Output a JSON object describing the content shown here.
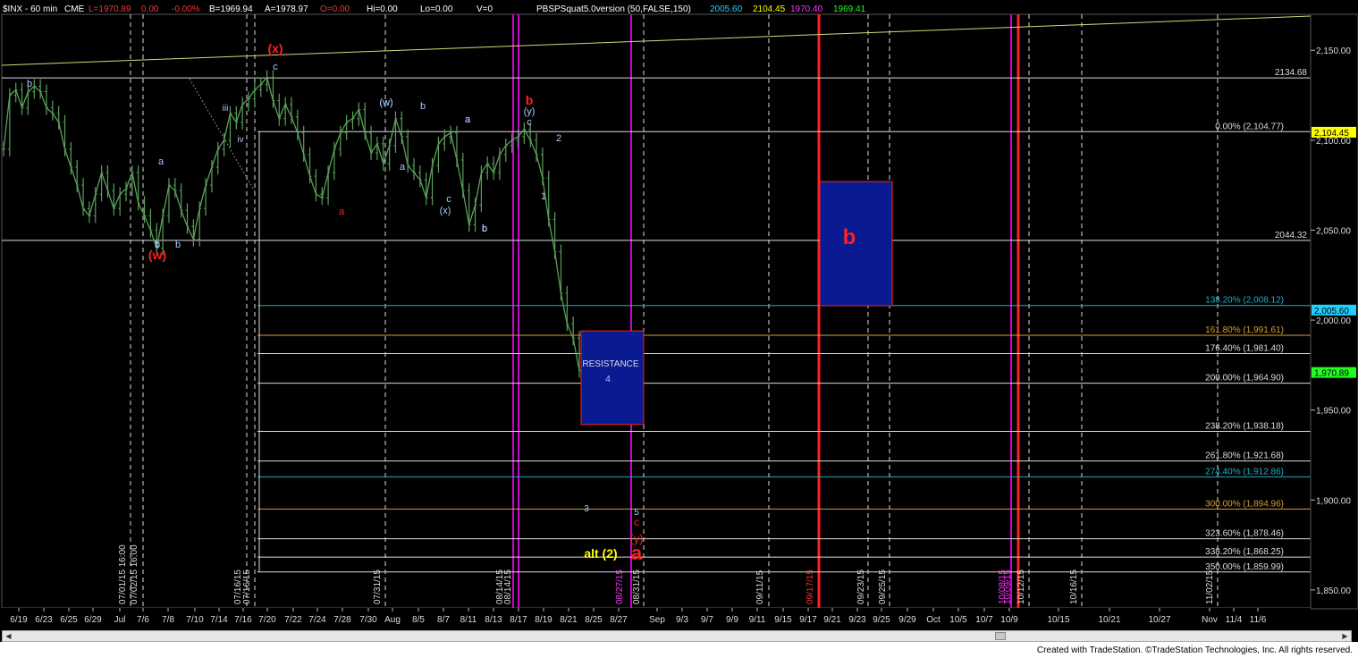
{
  "header": {
    "symbol": "$INX - 60 min",
    "exchange": "CME",
    "last": "L=1970.89",
    "change": "0.00",
    "pct": "-0.00%",
    "bid": "B=1969.94",
    "ask": "A=1978.97",
    "ask_extra": "O=0.00",
    "hi": "Hi=0.00",
    "lo": "Lo=0.00",
    "vol": "V=0",
    "indicator": "PBSPSquat5.0version (50,FALSE,150)",
    "ind_v1": "2005.60",
    "ind_v2": "2104.45",
    "ind_v3": "1970.40",
    "ind_v4": "1969.41"
  },
  "colors": {
    "background": "#000000",
    "price_bars": "#5aa05a",
    "fib_lines": "#dcdcdc",
    "channel_line": "#d7d77a",
    "red_lines": "#ff2020",
    "magenta_lines": "#d000d0",
    "resistance_box": "#0a1a90",
    "label_red": "#ff2020",
    "label_blue": "#aac8ff",
    "label_yellow": "#ffff00"
  },
  "chart_data": {
    "type": "line",
    "title": "$INX - 60 min",
    "ylim": [
      1840,
      2170
    ],
    "x_ticks": [
      "6/19",
      "6/23",
      "6/25",
      "6/29",
      "Jul",
      "7/6",
      "7/8",
      "7/10",
      "7/14",
      "7/16",
      "7/20",
      "7/22",
      "7/24",
      "7/28",
      "7/30",
      "Aug",
      "8/5",
      "8/7",
      "8/11",
      "8/13",
      "8/17",
      "8/19",
      "8/21",
      "8/25",
      "8/27",
      "Sep",
      "9/3",
      "9/7",
      "9/9",
      "9/11",
      "9/15",
      "9/17",
      "9/21",
      "9/23",
      "9/25",
      "9/29",
      "Oct",
      "10/5",
      "10/7",
      "10/9",
      "10/15",
      "10/21",
      "10/27",
      "Nov",
      "11/4",
      "11/6"
    ],
    "y_ticks": [
      "2,150.00",
      "2,100.00",
      "2,050.00",
      "2,000.00",
      "1,950.00",
      "1,900.00",
      "1,850.00"
    ],
    "y_tick_values": [
      2150,
      2100,
      2050,
      2000,
      1950,
      1900,
      1850
    ],
    "price_tags": [
      {
        "label": "2,104.45",
        "value": 2104.45,
        "color": "#ffff00"
      },
      {
        "label": "2,005.60",
        "value": 2005.6,
        "color": "#20d0ff"
      },
      {
        "label": "1,970.89",
        "value": 1970.89,
        "color": "#20ff20"
      }
    ],
    "series": [
      {
        "values": [
          2095,
          2125,
          2128,
          2118,
          2127,
          2130,
          2127,
          2118,
          2115,
          2110,
          2095,
          2085,
          2075,
          2062,
          2058,
          2070,
          2082,
          2072,
          2062,
          2070,
          2073,
          2082,
          2065,
          2058,
          2050,
          2040,
          2058,
          2075,
          2072,
          2061,
          2052,
          2045,
          2062,
          2075,
          2085,
          2095,
          2100,
          2115,
          2110,
          2120,
          2123,
          2128,
          2131,
          2135,
          2122,
          2112,
          2120,
          2113,
          2104,
          2092,
          2080,
          2070,
          2068,
          2082,
          2095,
          2104,
          2110,
          2112,
          2117,
          2104,
          2093,
          2098,
          2087,
          2097,
          2112,
          2102,
          2086,
          2082,
          2078,
          2068,
          2086,
          2098,
          2102,
          2104,
          2089,
          2072,
          2053,
          2064,
          2082,
          2087,
          2082,
          2092,
          2097,
          2100,
          2102,
          2106,
          2100,
          2092,
          2079,
          2056,
          2038,
          2015,
          1998,
          1990,
          1972
        ]
      }
    ],
    "fib_levels": [
      {
        "label": "0.00% (2,104.77)",
        "value": 2104.77,
        "color": "#dcdcdc"
      },
      {
        "label": "138.20% (2,008.12)",
        "value": 2008.12,
        "color": "#20b0c0"
      },
      {
        "label": "161.80% (1,991.61)",
        "value": 1991.61,
        "color": "#d7a030"
      },
      {
        "label": "176.40% (1,981.40)",
        "value": 1981.4,
        "color": "#dcdcdc"
      },
      {
        "label": "200.00% (1,964.90)",
        "value": 1964.9,
        "color": "#dcdcdc"
      },
      {
        "label": "238.20% (1,938.18)",
        "value": 1938.18,
        "color": "#dcdcdc"
      },
      {
        "label": "261.80% (1,921.68)",
        "value": 1921.68,
        "color": "#dcdcdc"
      },
      {
        "label": "274.40% (1,912.86)",
        "value": 1912.86,
        "color": "#20b0c0"
      },
      {
        "label": "300.00% (1,894.96)",
        "value": 1894.96,
        "color": "#d7a030"
      },
      {
        "label": "323.60% (1,878.46)",
        "value": 1878.46,
        "color": "#dcdcdc"
      },
      {
        "label": "338.20% (1,868.25)",
        "value": 1868.25,
        "color": "#dcdcdc"
      },
      {
        "label": "350.00% (1,859.99)",
        "value": 1859.99,
        "color": "#dcdcdc"
      }
    ],
    "horizontal_levels": [
      {
        "label": "2134.68",
        "value": 2134.68
      },
      {
        "label": "2044.32",
        "value": 2044.32
      }
    ],
    "vertical_date_labels": [
      "07/01/15 16:00",
      "07/02/15 16:00",
      "07/16/15",
      "07/16/15",
      "07/31/15",
      "08/14/15",
      "08/14/15",
      "08/27/15",
      "08/31/15",
      "09/11/15",
      "09/17/15",
      "09/23/15",
      "09/25/15",
      "10/08/15",
      "10/09/15",
      "10/12/15",
      "10/16/15",
      "11/02/15"
    ],
    "boxes": [
      {
        "label": "RESISTANCE",
        "sublabel": "4",
        "y_top": 1994,
        "y_bottom": 1942
      },
      {
        "label": "b",
        "y_top": 2077,
        "y_bottom": 2008
      }
    ],
    "wave_labels": [
      "(x)",
      "c",
      "b",
      "b",
      "iii",
      "iv",
      "(w)",
      "a",
      "c",
      "b",
      "a",
      "c",
      "b",
      "(w)",
      "a",
      "c",
      "b",
      "a",
      "(x)",
      "b",
      "a",
      "b",
      "(y)",
      "c",
      "2",
      "1",
      "3",
      "5",
      "c",
      "(y)",
      "a",
      "alt (2)"
    ]
  },
  "footer": {
    "copyright": "Created with TradeStation. ©TradeStation Technologies, Inc. All rights reserved."
  }
}
